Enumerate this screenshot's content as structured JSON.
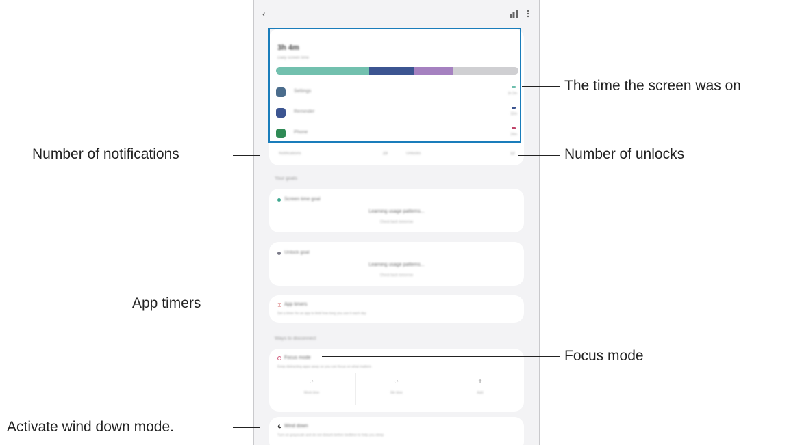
{
  "usage": {
    "time": "3h 4m",
    "sub": "Daily screen time",
    "segments_pct": [
      38,
      19,
      16
    ],
    "apps": [
      {
        "name": "Settings",
        "duration": "1h 2m",
        "color": "#4a6c8c",
        "mark": "#6fbfae"
      },
      {
        "name": "Reminder",
        "duration": "32m",
        "color": "#3c5591",
        "mark": "#3c5591"
      },
      {
        "name": "Phone",
        "duration": "24m",
        "color": "#2f8a55",
        "mark": "#c0456b"
      }
    ],
    "stats": {
      "notifications_label": "Notifications",
      "notifications_value": "23",
      "unlocks_label": "Unlocks",
      "unlocks_value": "12"
    }
  },
  "goals": {
    "title": "Your goals",
    "screen": {
      "head": "Screen time goal",
      "main": "Learning usage patterns...",
      "sub": "Check back tomorrow"
    },
    "unlock": {
      "head": "Unlock goal",
      "main": "Learning usage patterns...",
      "sub": "Check back tomorrow"
    }
  },
  "timers": {
    "title": "App timers",
    "desc": "Set a timer for an app to limit how long you use it each day"
  },
  "disconnect": {
    "title": "Ways to disconnect"
  },
  "focus": {
    "title": "Focus mode",
    "desc": "Keep distracting apps away so you can focus on what matters",
    "options": [
      {
        "label": "Work time",
        "icon": "◔"
      },
      {
        "label": "Me time",
        "icon": "◔"
      },
      {
        "label": "Add",
        "icon": "+"
      }
    ]
  },
  "wind": {
    "title": "Wind down",
    "desc": "Turn on grayscale and do not disturb before bedtime to help you sleep"
  },
  "callouts": {
    "screen_on": "The time the screen was on",
    "notifications": "Number of notifications",
    "unlocks": "Number of unlocks",
    "app_timers": "App timers",
    "focus_mode": "Focus mode",
    "wind_down": "Activate wind down mode."
  },
  "colors": {
    "highlight": "#1a7dbb",
    "seg_a": "#72c0ae",
    "seg_b": "#3c5591",
    "seg_c": "#a581c0"
  }
}
